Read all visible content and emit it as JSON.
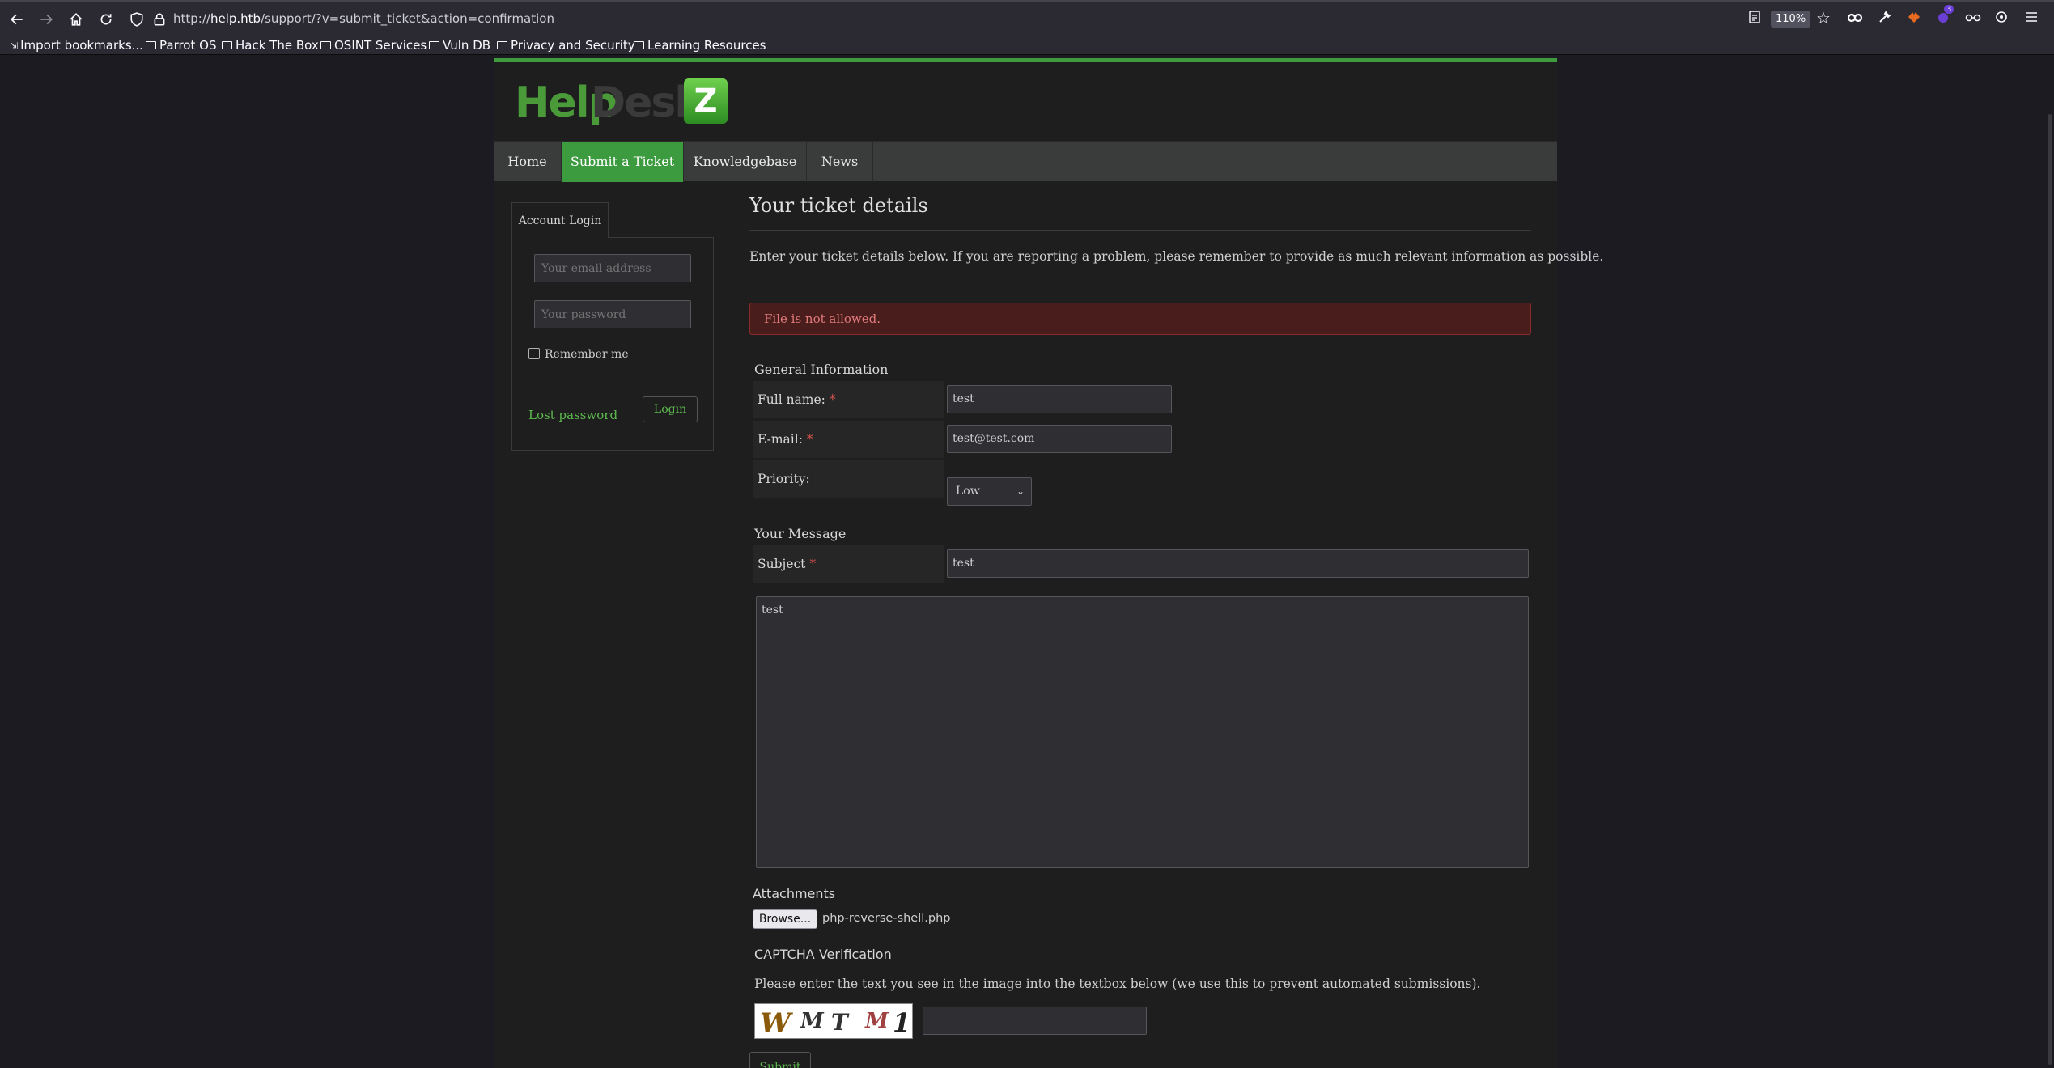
{
  "browser": {
    "url_prefix": "http://",
    "url_host": "help.htb",
    "url_path": "/support/?v=submit_ticket&action=confirmation",
    "zoom": "110%",
    "extension_badge": "3"
  },
  "bookmarks": [
    "Import bookmarks...",
    "Parrot OS",
    "Hack The Box",
    "OSINT Services",
    "Vuln DB",
    "Privacy and Security",
    "Learning Resources"
  ],
  "site": {
    "logo_part1": "Help",
    "logo_part2": "Desk",
    "logo_z": "Z"
  },
  "nav": {
    "items": [
      "Home",
      "Submit a Ticket",
      "Knowledgebase",
      "News"
    ],
    "active": "Submit a Ticket"
  },
  "login": {
    "tab": "Account Login",
    "email_placeholder": "Your email address",
    "password_placeholder": "Your password",
    "remember_me": "Remember me",
    "lost_password": "Lost password",
    "login_button": "Login"
  },
  "ticket": {
    "title": "Your ticket details",
    "intro": "Enter your ticket details below. If you are reporting a problem, please remember to provide as much relevant information as possible.",
    "error": "File is not allowed.",
    "general_heading": "General Information",
    "fullname_label": "Full name:",
    "fullname_value": "test",
    "email_label": "E-mail:",
    "email_value": "test@test.com",
    "priority_label": "Priority:",
    "priority_value": "Low",
    "message_heading": "Your Message",
    "subject_label": "Subject",
    "subject_value": "test",
    "message_value": "test",
    "required_mark": "*",
    "attachments_heading": "Attachments",
    "browse_button": "Browse...",
    "file_name": "php-reverse-shell.php",
    "captcha_heading": "CAPTCHA Verification",
    "captcha_instructions": "Please enter the text you see in the image into the textbox below (we use this to prevent automated submissions).",
    "captcha_chars": [
      "W",
      "M",
      "T",
      "M",
      "1"
    ],
    "submit_button": "Submit"
  },
  "colors": {
    "accent_green": "#3c9a3f",
    "link_green": "#5dba4f",
    "error_bg": "#4a1d1d",
    "error_text": "#e07a7a"
  }
}
